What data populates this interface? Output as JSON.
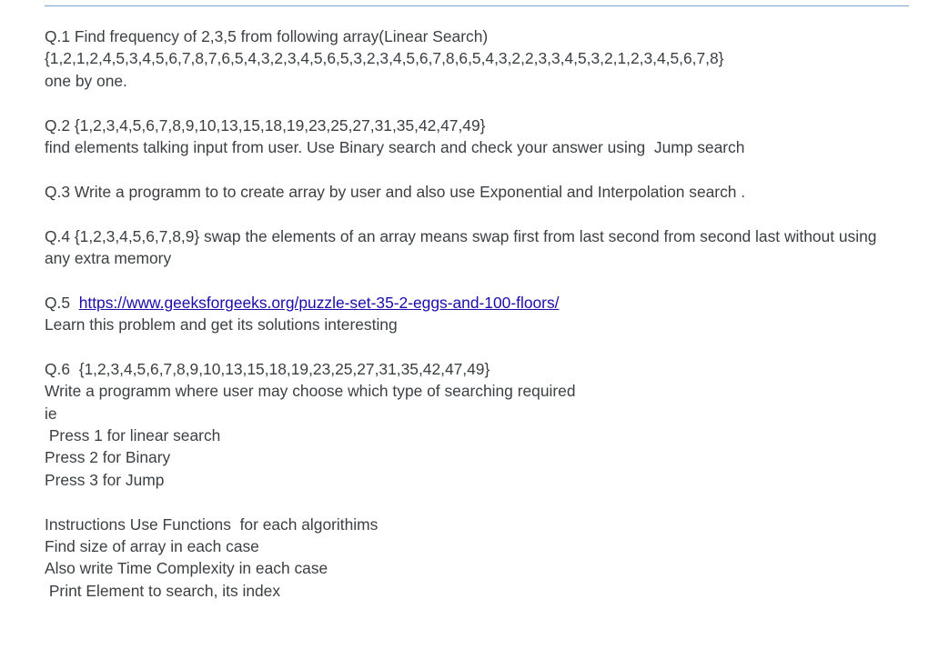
{
  "questions": {
    "q1": {
      "line1": "Q.1 Find frequency of 2,3,5 from following array(Linear Search)",
      "line2": "{1,2,1,2,4,5,3,4,5,6,7,8,7,6,5,4,3,2,3,4,5,6,5,3,2,3,4,5,6,7,8,6,5,4,3,2,2,3,3,4,5,3,2,1,2,3,4,5,6,7,8}",
      "line3": "one by one."
    },
    "q2": {
      "line1": "Q.2 {1,2,3,4,5,6,7,8,9,10,13,15,18,19,23,25,27,31,35,42,47,49}",
      "line2": "find elements talking input from user. Use Binary search and check your answer using  Jump search"
    },
    "q3": {
      "line1": "Q.3 Write a programm to to create array by user and also use Exponential and Interpolation search ."
    },
    "q4": {
      "line1": "Q.4 {1,2,3,4,5,6,7,8,9} swap the elements of an array means swap first from last second from second last without using",
      "line2": "any extra memory"
    },
    "q5": {
      "prefix": "Q.5  ",
      "link": "https://www.geeksforgeeks.org/puzzle-set-35-2-eggs-and-100-floors/",
      "line2": "Learn this problem and get its solutions interesting"
    },
    "q6": {
      "line1": "Q.6  {1,2,3,4,5,6,7,8,9,10,13,15,18,19,23,25,27,31,35,42,47,49}",
      "line2": "Write a programm where user may choose which type of searching required",
      "line3": "ie",
      "line4": " Press 1 for linear search",
      "line5": "Press 2 for Binary",
      "line6": "Press 3 for Jump"
    }
  },
  "instructions": {
    "line1": "Instructions Use Functions  for each algorithims",
    "line2": "Find size of array in each case",
    "line3": "Also write Time Complexity in each case",
    "line4": " Print Element to search, its index"
  }
}
